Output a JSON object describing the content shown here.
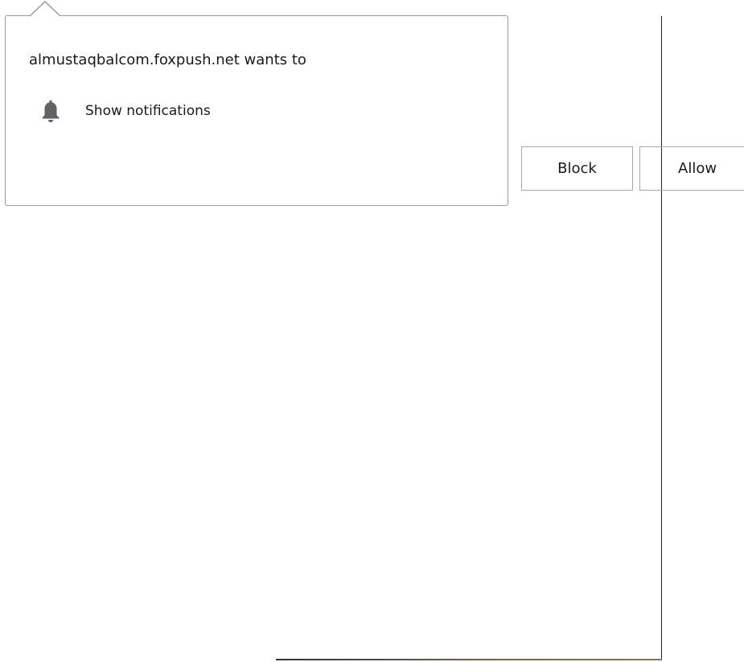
{
  "prompt": {
    "title": "almustaqbalcom.foxpush.net wants to",
    "permission": {
      "icon": "bell-icon",
      "label": "Show notifications"
    }
  },
  "buttons": {
    "block_label": "Block",
    "allow_label": "Allow"
  },
  "colors": {
    "icon": "#5f6368",
    "border": "#9a9a9a",
    "text": "#1a1a1a"
  }
}
